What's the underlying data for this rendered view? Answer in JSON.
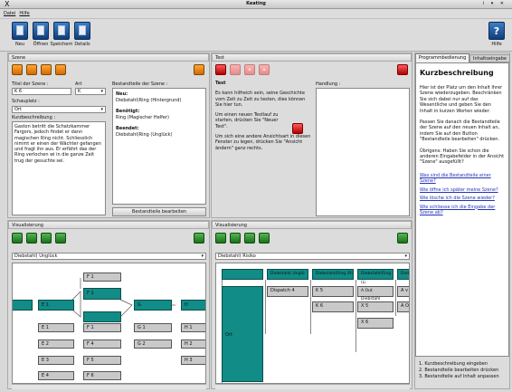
{
  "window": {
    "title": "Keating",
    "logo": "X",
    "controls": "i ▾ ✕"
  },
  "menu": {
    "file": "Datei",
    "help": "Hilfe"
  },
  "toolbar": {
    "new": "Neu",
    "open": "Öffnen",
    "save": "Speichern",
    "details": "Details",
    "help": "Hilfe"
  },
  "scene": {
    "header": "Szene",
    "title_label": "Titel der Szene :",
    "title_value": "K 6",
    "type_label": "Art",
    "type_value": "K",
    "place_label": "Schauplatz :",
    "place_value": "Ort",
    "summary_label": "Kurzbeschreibung :",
    "summary_text": "Gaston betritt die Schatzkammer Fargors, jedoch findet er dann magischen Ring nicht. Schliesslich nimmt er einen der Wächter gefangen und fragt ihn aus. Er erfährt das der Ring verlochen wi in die ganze Zeit trug der gesuchte sei.",
    "parts_label": "Bestandteile der Szene :",
    "new_label": "Neu:",
    "new_value": "Diebstahl(Ring (Hintergrund)",
    "needed_label": "Benötigt:",
    "needed_value": "Ring (Magischer Helfer)",
    "ended_label": "Beendet:",
    "ended_value": "Diebstahl(Ring (Unglück)",
    "edit_parts_button": "Bestandteile bearbeiten"
  },
  "test": {
    "header": "Test",
    "title": "Test",
    "action_label": "Handlung :",
    "p1": "Es kann hilfreich sein, seine Geschichte vom Zeit zu Zeit zu testen, dies können Sie hier tun.",
    "p2": "Um einen neuen Testlauf zu starten, drücken Sie \"Neuer Test\".",
    "p3": "Um sich eine andere Ansichtsart in diesen Fenster zu legen, drücken Sie \"Ansicht ändern\" ganz rechts."
  },
  "help": {
    "tab1": "Programmbedienung",
    "tab2": "Inhaltseingabe",
    "title": "Kurzbeschreibung",
    "p1": "Hier ist der Platz um den Inhalt Ihrer Szene wiederzugeben. Beschränken Sie sich dabei nur auf das Wesentliche und geben Sie den Inhalt in kurzen Worten wieder.",
    "p2": "Passen Sie danach die Bestandteile der Szene auf den neuen Inhalt an, indem Sie auf den Button \"Bestandteile bearbeiten\" drücken.",
    "p3": "Übrigens: Haben Sie schon die anderen Eingabefelder in der Ansicht \"Szene\" ausgefüllt?",
    "links": [
      "Was sind die Bestandteile einer Szene?",
      "Wie öffne ich später meine Szene?",
      "Wie lösche ich die Szene wieder?",
      "Wie schliesse ich die Eingabe der Szene ab?"
    ],
    "steps": [
      "1.  Kurzbeschreibung eingeben",
      "2.  Bestandteile bearbeiten drücken",
      "3.  Bestandteile auf Inhalt anpassen"
    ]
  },
  "vis_left": {
    "header": "Visualisierung",
    "select": "Diebstahl( Unglück",
    "boxes": [
      "F 1",
      "F 1",
      "E 1",
      "G",
      "H",
      "E 1",
      "F 1",
      "G 1",
      "H 1",
      "E 2",
      "F 4",
      "G 2",
      "H 2",
      "E 3",
      "F 5",
      "H 3",
      "E 4",
      "F 6"
    ]
  },
  "vis_right": {
    "header": "Visualisierung",
    "select": "Diebstahl( Risiko",
    "col_headers": [
      "Diebstahl( Unglü",
      "Diebstahl(Ring (Ri",
      "Diebstahl(Ring (Li",
      "Dieb"
    ],
    "cells": [
      "Ort",
      "Dispatch 4",
      "K 5",
      "A Out Diebstahl",
      "A v",
      "K 6",
      "X 5",
      "A O",
      "X 6"
    ]
  }
}
